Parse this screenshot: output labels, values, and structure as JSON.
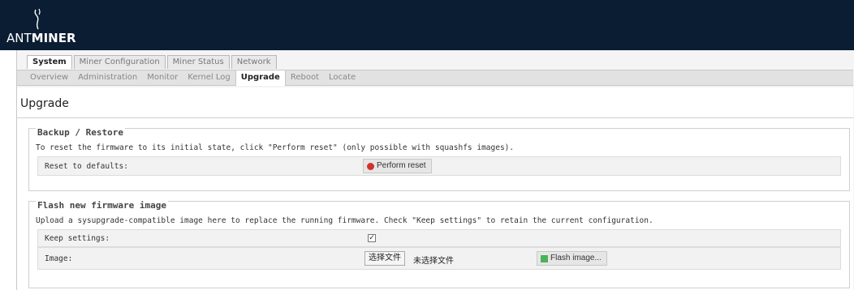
{
  "brand": {
    "prefix": "ANT",
    "suffix": "MINER"
  },
  "top_tabs": [
    {
      "label": "System",
      "active": true
    },
    {
      "label": "Miner Configuration",
      "active": false
    },
    {
      "label": "Miner Status",
      "active": false
    },
    {
      "label": "Network",
      "active": false
    }
  ],
  "sub_tabs": [
    {
      "label": "Overview",
      "active": false
    },
    {
      "label": "Administration",
      "active": false
    },
    {
      "label": "Monitor",
      "active": false
    },
    {
      "label": "Kernel Log",
      "active": false
    },
    {
      "label": "Upgrade",
      "active": true
    },
    {
      "label": "Reboot",
      "active": false
    },
    {
      "label": "Locate",
      "active": false
    }
  ],
  "page": {
    "title": "Upgrade",
    "backup": {
      "legend": "Backup / Restore",
      "description": "To reset the firmware to its initial state, click \"Perform reset\" (only possible with squashfs images).",
      "reset_label": "Reset to defaults:",
      "reset_button": "Perform reset"
    },
    "flash": {
      "legend": "Flash new firmware image",
      "description": "Upload a sysupgrade-compatible image here to replace the running firmware. Check \"Keep settings\" to retain the current configuration.",
      "keep_label": "Keep settings:",
      "keep_checked": true,
      "image_label": "Image:",
      "choose_file": "选择文件",
      "no_file": "未选择文件",
      "flash_button": "Flash image..."
    }
  }
}
